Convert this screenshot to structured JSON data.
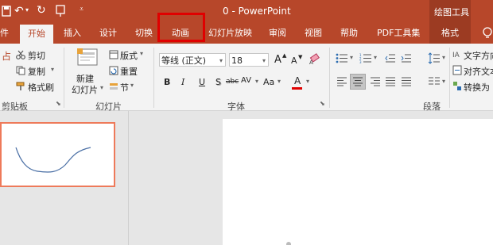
{
  "title": {
    "doc": "0  -  PowerPoint",
    "context": "绘图工具"
  },
  "tabs": [
    {
      "label": "件"
    },
    {
      "label": "开始"
    },
    {
      "label": "插入"
    },
    {
      "label": "设计"
    },
    {
      "label": "切换"
    },
    {
      "label": "动画"
    },
    {
      "label": "幻灯片放映"
    },
    {
      "label": "审阅"
    },
    {
      "label": "视图"
    },
    {
      "label": "帮助"
    },
    {
      "label": "PDF工具集"
    },
    {
      "label": "格式"
    }
  ],
  "clipboard": {
    "cut": "剪切",
    "copy": "复制",
    "format_painter": "格式刷",
    "paste_fragment": "占",
    "group_label": "剪贴板"
  },
  "slides": {
    "new_slide": "新建",
    "new_slide2": "幻灯片",
    "layout": "版式",
    "reset": "重置",
    "section": "节",
    "group_label": "幻灯片"
  },
  "font": {
    "name": "等线 (正文)",
    "size": "18",
    "group_label": "字体",
    "bold": "B",
    "italic": "I",
    "underline": "U",
    "shadow": "S",
    "strike": "abc",
    "spacing": "AV",
    "case": "Aa",
    "color": "A",
    "grow": "A",
    "shrink": "A"
  },
  "paragraph": {
    "text_direction": "文字方向",
    "align_text": "对齐文本",
    "convert": "转换为",
    "group_label": "段落"
  },
  "colors": {
    "accent": "#b7472a",
    "highlight": "#e00000",
    "thumb_border": "#ee7a5a"
  }
}
